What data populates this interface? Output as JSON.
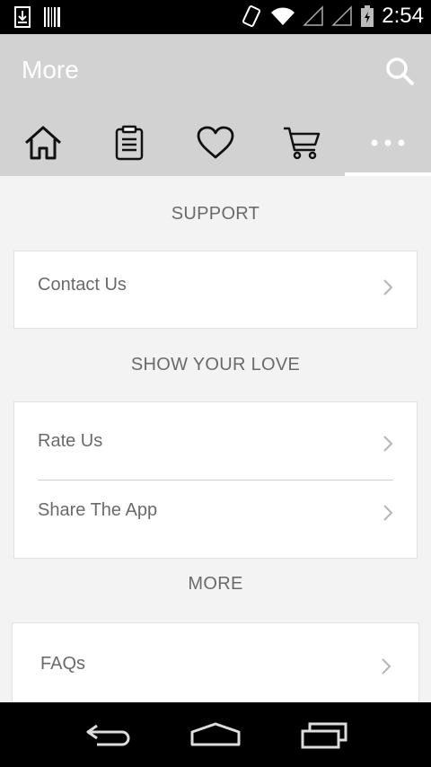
{
  "status_bar": {
    "time": "2:54",
    "icons": [
      "download-icon",
      "barcode-icon",
      "vibrate-icon",
      "wifi-icon",
      "signal-icon",
      "signal-icon",
      "battery-icon"
    ]
  },
  "header": {
    "title": "More",
    "search_icon": "search-icon",
    "background": "#d2d2d2"
  },
  "tabs": [
    {
      "icon": "home-icon",
      "active": false
    },
    {
      "icon": "clipboard-icon",
      "active": false
    },
    {
      "icon": "heart-icon",
      "active": false
    },
    {
      "icon": "cart-icon",
      "active": false
    },
    {
      "icon": "more-icon",
      "active": true
    }
  ],
  "sections": {
    "support": {
      "title": "SUPPORT",
      "items": [
        {
          "label": "Contact Us"
        }
      ]
    },
    "show_your_love": {
      "title": "SHOW YOUR LOVE",
      "items": [
        {
          "label": "Rate Us"
        },
        {
          "label": "Share The App"
        }
      ]
    },
    "more": {
      "title": "MORE",
      "items": [
        {
          "label": "FAQs"
        }
      ]
    }
  },
  "nav_bar": {
    "icons": [
      "back-icon",
      "home-nav-icon",
      "recents-icon"
    ]
  }
}
